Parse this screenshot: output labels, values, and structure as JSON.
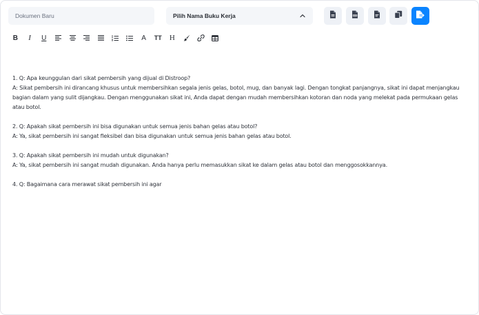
{
  "header": {
    "document_title_placeholder": "Dokumen Baru",
    "workbook_select": {
      "label": "Pilih Nama Buku Kerja",
      "icon": "chevron-up-icon"
    },
    "actions": [
      {
        "name": "export-doc-button",
        "icon": "file-doc-icon"
      },
      {
        "name": "export-pdf-button",
        "icon": "file-pdf-icon"
      },
      {
        "name": "export-file-button",
        "icon": "file-icon"
      },
      {
        "name": "copy-button",
        "icon": "copy-icon"
      },
      {
        "name": "save-button",
        "icon": "file-arrow-icon",
        "color": "#0a84ff"
      }
    ]
  },
  "toolbar": {
    "bold": "B",
    "italic": "I",
    "underline": "U",
    "font_color": "A",
    "font_size": "TT",
    "heading": "H"
  },
  "editor": {
    "paragraphs": [
      {
        "question": "1. Q: Apa keunggulan dari sikat pembersih yang dijual di Distroop?",
        "answer": "A: Sikat pembersih ini dirancang khusus untuk membersihkan segala jenis gelas, botol, mug, dan banyak lagi. Dengan tongkat panjangnya, sikat ini dapat menjangkau bagian dalam yang sulit dijangkau. Dengan menggunakan sikat ini, Anda dapat dengan mudah membersihkan kotoran dan noda yang melekat pada permukaan gelas atau botol."
      },
      {
        "question": "2. Q: Apakah sikat pembersih ini bisa digunakan untuk semua jenis bahan gelas atau botol?",
        "answer": "A: Ya, sikat pembersih ini sangat fleksibel dan bisa digunakan untuk semua jenis bahan gelas atau botol."
      },
      {
        "question": "3. Q: Apakah sikat pembersih ini mudah untuk digunakan?",
        "answer": "A: Ya, sikat pembersih ini sangat mudah digunakan. Anda hanya perlu memasukkan sikat ke dalam gelas atau botol dan menggosokkannya."
      },
      {
        "question": "4. Q: Bagaimana cara merawat sikat pembersih ini agar",
        "answer": ""
      }
    ]
  }
}
